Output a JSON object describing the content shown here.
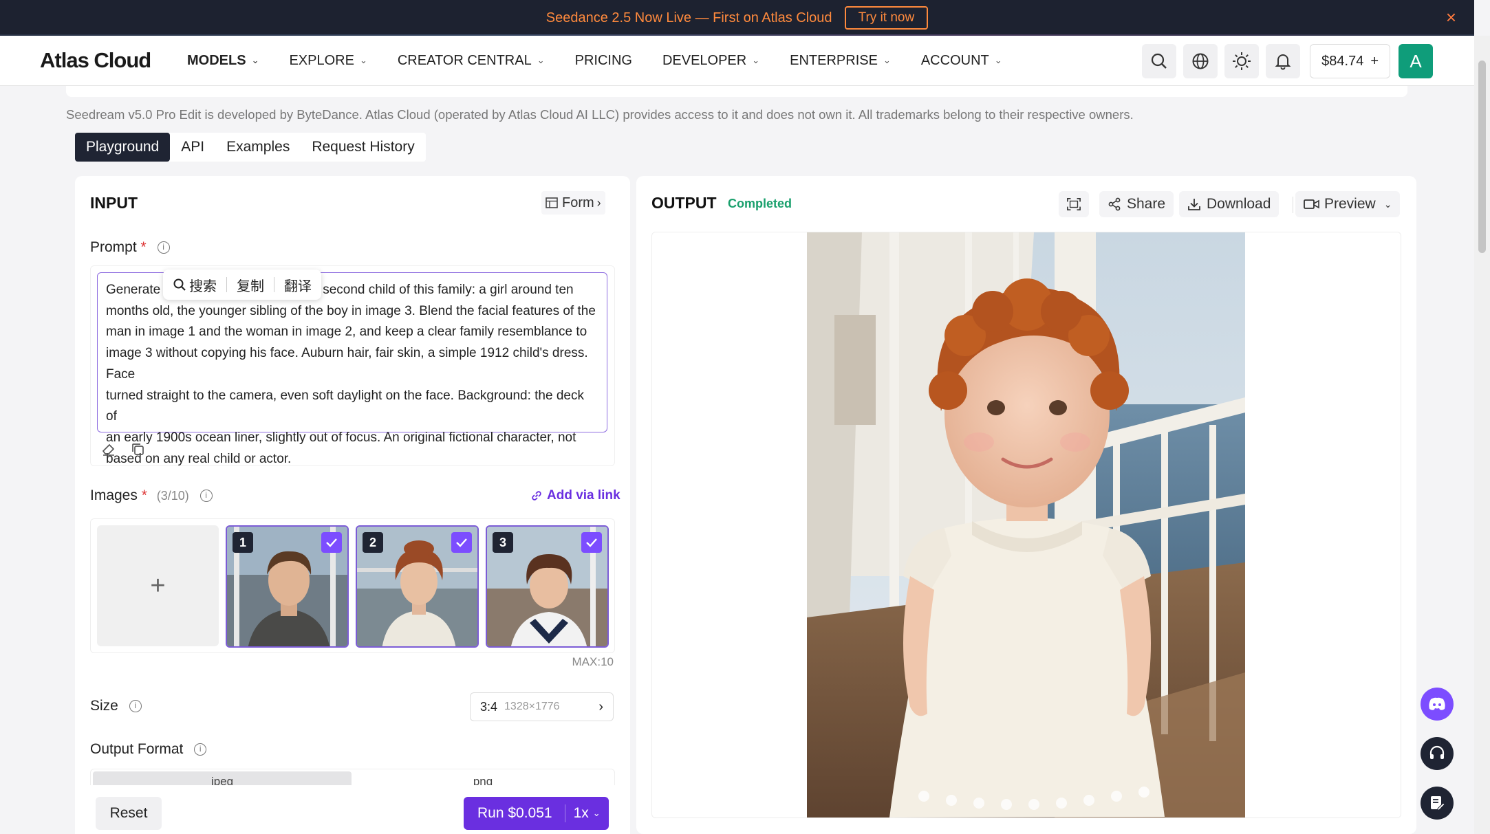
{
  "banner": {
    "text": "Seedance 2.5 Now Live — First on Atlas Cloud",
    "cta": "Try it now",
    "close": "×"
  },
  "nav": {
    "logo": "Atlas Cloud",
    "items": [
      "MODELS",
      "EXPLORE",
      "CREATOR CENTRAL",
      "PRICING",
      "DEVELOPER",
      "ENTERPRISE",
      "ACCOUNT"
    ],
    "balance": "$84.74",
    "balance_plus": "+",
    "avatar": "A"
  },
  "disclaimer": "Seedream v5.0 Pro Edit is developed by ByteDance. Atlas Cloud (operated by Atlas Cloud AI LLC) provides access to it and does not own it. All trademarks belong to their respective owners.",
  "tabs": [
    "Playground",
    "API",
    "Examples",
    "Request History"
  ],
  "input": {
    "title": "INPUT",
    "form_btn": "Form",
    "prompt_label": "Prompt",
    "required": "*",
    "prompt_lines": [
      "Generate [image] the second child of this family: a girl around ten",
      "months old, the younger sibling of the boy in image 3. Blend the facial features of the",
      "man in image 1 and the woman in image 2, and keep a clear family resemblance to",
      "image 3 without copying his face. Auburn hair, fair skin, a simple 1912 child's dress. Face",
      "turned straight to the camera, even soft daylight on the face. Background: the deck of",
      "an early 1900s ocean liner, slightly out of focus. An original fictional character, not",
      "based on any real child or actor."
    ],
    "prompt_first_visible": "Generate",
    "prompt_first_rest": "second child of this family: a girl around ten",
    "context_menu": [
      "搜索",
      "复制",
      "翻译"
    ],
    "images_label": "Images",
    "images_count": "(3/10)",
    "add_via_link": "Add via link",
    "add_plus": "+",
    "thumb_nums": [
      "1",
      "2",
      "3"
    ],
    "max_label": "MAX:10",
    "size_label": "Size",
    "size_ratio": "3:4",
    "size_dims": "1328×1776",
    "format_label": "Output Format",
    "formats": [
      "jpeg",
      "png"
    ],
    "reset": "Reset",
    "run": "Run $0.051",
    "multiplier": "1x"
  },
  "output": {
    "title": "OUTPUT",
    "status": "Completed",
    "share": "Share",
    "download": "Download",
    "preview": "Preview"
  },
  "colors": {
    "accent": "#6a2fe0",
    "status": "#1aa06d",
    "banner_bg": "#1d2230",
    "banner_fg": "#ff8a3d"
  }
}
